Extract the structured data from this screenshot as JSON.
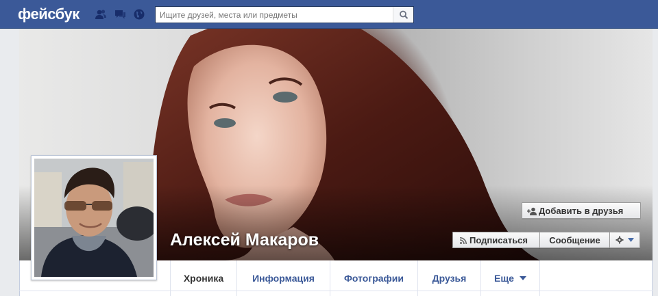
{
  "topbar": {
    "logo": "фейсбук",
    "icons": [
      "friend-requests-icon",
      "messages-icon",
      "notifications-globe-icon",
      "search-icon"
    ],
    "search_placeholder": "Ищите друзей, места или предметы"
  },
  "profile": {
    "name": "Алексей Макаров"
  },
  "actions": {
    "add_friend": "Добавить в друзья",
    "subscribe": "Подписаться",
    "message": "Сообщение"
  },
  "tabs": [
    {
      "label": "Хроника",
      "active": true
    },
    {
      "label": "Информация",
      "active": false
    },
    {
      "label": "Фотографии",
      "active": false
    },
    {
      "label": "Друзья",
      "active": false
    },
    {
      "label": "Еще",
      "active": false
    }
  ],
  "colors": {
    "brand_blue": "#3b5998",
    "page_bg": "#e9ebee"
  }
}
